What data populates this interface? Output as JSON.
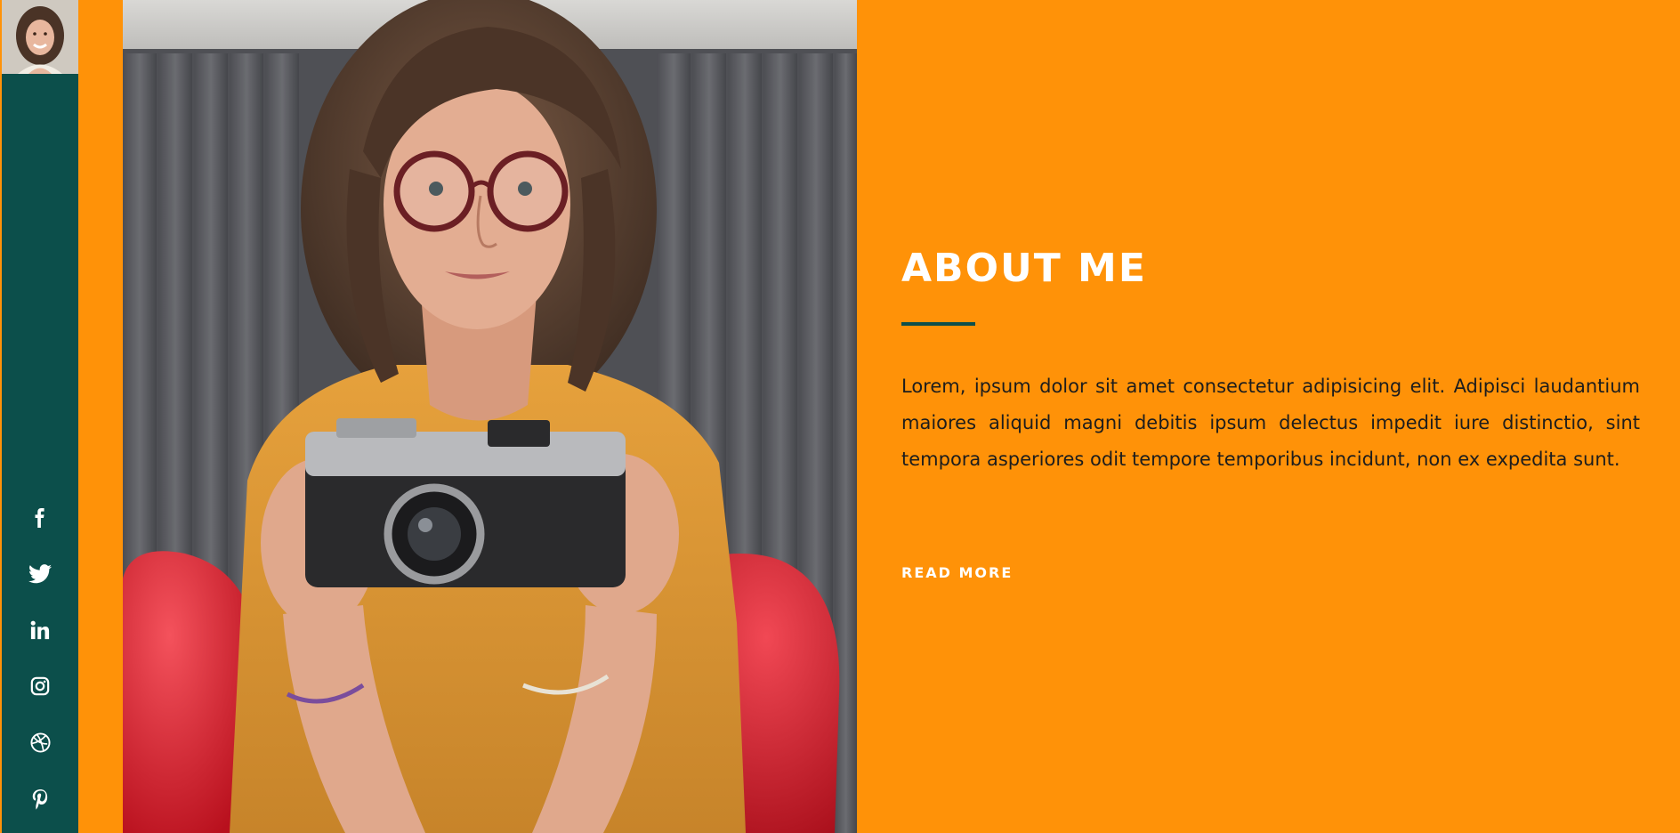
{
  "colors": {
    "background": "#ff9208",
    "sidebar": "#0c4f4b",
    "accent_rule": "#0c4f4b",
    "heading": "#ffffff",
    "body_text": "#1d1d1d"
  },
  "sidebar": {
    "avatar": "profile-photo",
    "social": [
      {
        "name": "facebook",
        "icon": "facebook-icon"
      },
      {
        "name": "twitter",
        "icon": "twitter-icon"
      },
      {
        "name": "linkedin",
        "icon": "linkedin-icon"
      },
      {
        "name": "instagram",
        "icon": "instagram-icon"
      },
      {
        "name": "dribbble",
        "icon": "dribbble-icon"
      },
      {
        "name": "pinterest",
        "icon": "pinterest-icon"
      }
    ]
  },
  "hero_image": "woman-with-camera-photo",
  "about": {
    "title": "ABOUT ME",
    "body": "Lorem, ipsum dolor sit amet consectetur adipisicing elit. Adipisci laudantium maiores aliquid magni debitis ipsum delectus impedit iure distinctio, sint tempora asperiores odit tempore temporibus incidunt, non ex expedita sunt.",
    "cta": "READ MORE"
  }
}
